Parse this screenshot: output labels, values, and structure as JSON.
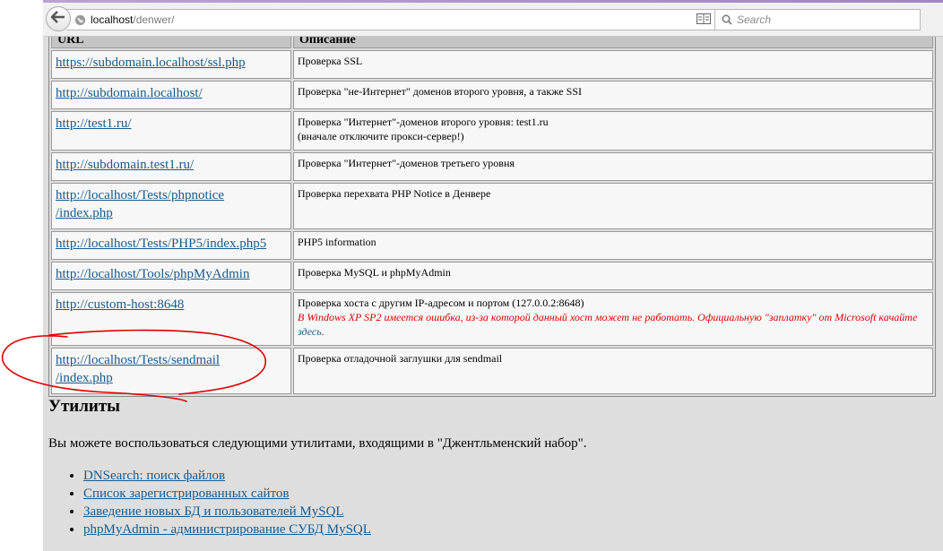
{
  "browser": {
    "url_host": "localhost",
    "url_path": "/denwer/",
    "search_placeholder": "Search"
  },
  "table": {
    "headers": [
      "URL",
      "Описание"
    ],
    "rows": [
      {
        "url": "https://subdomain.localhost/ssl.php",
        "desc": "Проверка SSL"
      },
      {
        "url": "http://subdomain.localhost/",
        "desc": "Проверка \"не-Интернет\" доменов второго уровня, а также SSI"
      },
      {
        "url": "http://test1.ru/",
        "desc": "Проверка \"Интернет\"-доменов второго уровня: test1.ru",
        "desc2": "(вначале отключите прокси-сервер!)"
      },
      {
        "url": "http://subdomain.test1.ru/",
        "desc": "Проверка \"Интернет\"-доменов третьего уровня"
      },
      {
        "url": "http://localhost/Tests/phpnotice",
        "url2": "/index.php",
        "desc": "Проверка перехвата PHP Notice в Денвере"
      },
      {
        "url": "http://localhost/Tests/PHP5/index.php5",
        "desc": "PHP5 information"
      },
      {
        "url": "http://localhost/Tools/phpMyAdmin",
        "desc": "Проверка MySQL и phpMyAdmin"
      },
      {
        "url": "http://custom-host:8648",
        "desc": "Проверка хоста с другим IP-адресом и портом (127.0.0.2:8648)",
        "warn": "В Windows XP SP2 имеется ошибка, из-за которой данный хост может не работать. Официальную \"заплатку\" от Microsoft качайте ",
        "warn_link": "здесь",
        "warn_end": "."
      },
      {
        "url": "http://localhost/Tests/sendmail",
        "url2": "/index.php",
        "desc": "Проверка отладочной заглушки для sendmail"
      }
    ]
  },
  "utilities": {
    "title": "Утилиты",
    "intro": "Вы можете воспользоваться следующими утилитами, входящими в \"Джентльменский набор\".",
    "items": [
      "DNSearch: поиск файлов",
      "Список зарегистрированных сайтов",
      "Заведение новых БД и пользователей MySQL",
      "phpMyAdmin - администрирование СУБД MySQL"
    ]
  },
  "colors": {
    "annotation": "#e00000",
    "link": "#1a5a8a"
  }
}
